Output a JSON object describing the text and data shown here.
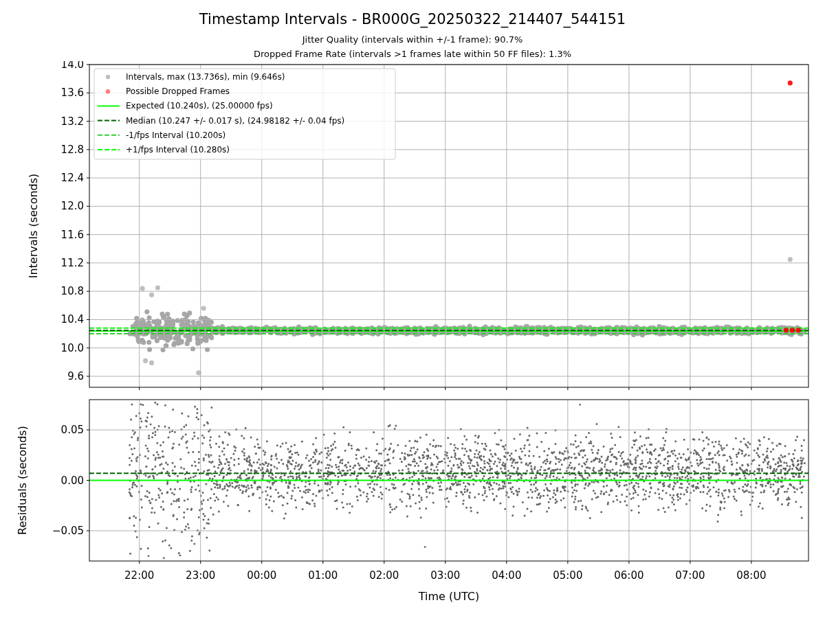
{
  "figure": {
    "title": "Timestamp Intervals - BR000G_20250322_214407_544151",
    "subtitle_lines": [
      "Jitter Quality (intervals within +/-1 frame): 90.7%",
      "Dropped Frame Rate (intervals >1 frames late within 50 FF files): 1.3%"
    ]
  },
  "top_chart": {
    "chart_data": {
      "type": "scatter",
      "ylabel": "Intervals (seconds)",
      "grid": true,
      "legend": true,
      "xlim": [
        "2025-03-22T21:11",
        "2025-03-23T08:56"
      ],
      "ylim": [
        9.445,
        14.0
      ],
      "yticks": [
        {
          "value": 9.6,
          "label": "9.6"
        },
        {
          "value": 10.0,
          "label": "10.0"
        },
        {
          "value": 10.4,
          "label": "10.4"
        },
        {
          "value": 10.8,
          "label": "10.8"
        },
        {
          "value": 11.2,
          "label": "11.2"
        },
        {
          "value": 11.6,
          "label": "11.6"
        },
        {
          "value": 12.0,
          "label": "12.0"
        },
        {
          "value": 12.4,
          "label": "12.4"
        },
        {
          "value": 12.8,
          "label": "12.8"
        },
        {
          "value": 13.2,
          "label": "13.2"
        },
        {
          "value": 13.6,
          "label": "13.6"
        },
        {
          "value": 14.0,
          "label": "14.0"
        }
      ],
      "series": [
        {
          "name": "Intervals, max (13.736s), min (9.646s)",
          "color": "#808080",
          "x": [
            "2025-03-22T22:03",
            "2025-03-22T22:12",
            "2025-03-22T22:18",
            "2025-03-22T22:06",
            "2025-03-22T22:12",
            "2025-03-22T22:58",
            "2025-03-22T23:03",
            "2025-03-23T08:38"
          ],
          "values": [
            10.84,
            10.75,
            10.85,
            9.82,
            9.79,
            9.65,
            10.56,
            11.25
          ]
        },
        {
          "name": "Possible Dropped Frames",
          "color": "#ff0000",
          "x": [
            "2025-03-23T08:38",
            "2025-03-23T08:34",
            "2025-03-23T08:40",
            "2025-03-23T08:46"
          ],
          "values": [
            13.74,
            10.25,
            10.25,
            10.25
          ]
        }
      ],
      "ref_lines": [
        {
          "axis": "y",
          "value": 10.24,
          "label": "Expected (10.240s), (25.00000 fps)",
          "color": "#00ff00"
        },
        {
          "axis": "y",
          "value": 10.247,
          "label": "Median (10.247 +/- 0.017 s), (24.98182 +/- 0.04 fps)",
          "color": "#006400"
        },
        {
          "axis": "y",
          "value": 10.2,
          "label": "-1/fps Interval (10.200s)",
          "color": "#32cd32"
        },
        {
          "axis": "y",
          "value": 10.28,
          "label": "+1/fps Interval (10.280s)",
          "color": "#00ff00"
        }
      ]
    }
  },
  "bottom_chart": {
    "chart_data": {
      "type": "scatter",
      "grid": true,
      "xlabel": "Time (UTC)",
      "ylabel": "Residuals (seconds)",
      "xlim": [
        "2025-03-22T21:11",
        "2025-03-23T08:56"
      ],
      "ylim": [
        -0.08,
        0.08
      ],
      "xticks": [
        {
          "value": "2025-03-22T22:00",
          "label": "22:00"
        },
        {
          "value": "2025-03-22T23:00",
          "label": "23:00"
        },
        {
          "value": "2025-03-23T00:00",
          "label": "00:00"
        },
        {
          "value": "2025-03-23T01:00",
          "label": "01:00"
        },
        {
          "value": "2025-03-23T02:00",
          "label": "02:00"
        },
        {
          "value": "2025-03-23T03:00",
          "label": "03:00"
        },
        {
          "value": "2025-03-23T04:00",
          "label": "04:00"
        },
        {
          "value": "2025-03-23T05:00",
          "label": "05:00"
        },
        {
          "value": "2025-03-23T06:00",
          "label": "06:00"
        },
        {
          "value": "2025-03-23T07:00",
          "label": "07:00"
        },
        {
          "value": "2025-03-23T08:00",
          "label": "08:00"
        }
      ],
      "yticks": [
        {
          "value": -0.05,
          "label": "−0.05"
        },
        {
          "value": 0,
          "label": "0.00"
        },
        {
          "value": 0.05,
          "label": "0.05"
        }
      ],
      "series": [
        {
          "color": "#606060",
          "x": [
            "2025-03-22T22:09",
            "2025-03-22T22:24",
            "2025-03-22T22:54",
            "2025-03-23T02:40",
            "2025-03-23T05:12"
          ],
          "values": [
            -0.075,
            -0.077,
            -0.063,
            -0.066,
            0.075
          ]
        }
      ],
      "ref_lines": [
        {
          "axis": "y",
          "value": 0.007,
          "color": "#006400"
        },
        {
          "axis": "y",
          "value": 0,
          "color": "#00ff00"
        }
      ]
    }
  }
}
